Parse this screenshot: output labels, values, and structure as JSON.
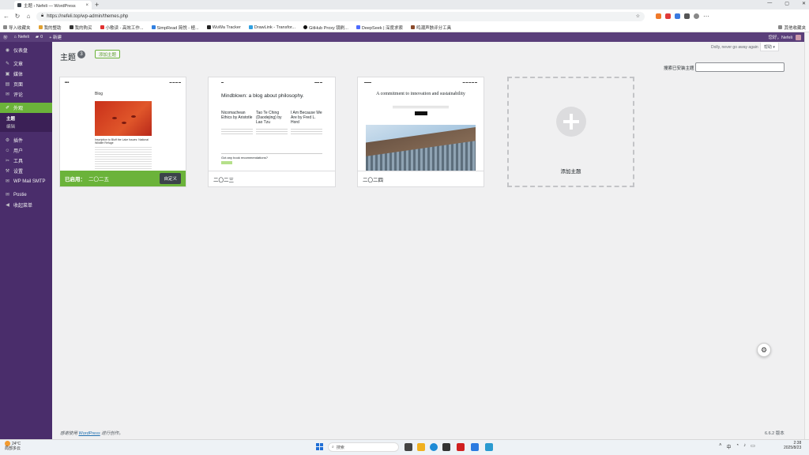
{
  "browser": {
    "tab_title": "主题 ‹ Nefeli — WordPress",
    "tab_close": "×",
    "new_tab": "+",
    "url": "https://nefeli.top/wp-admin/themes.php",
    "window_controls": [
      "—",
      "▢",
      "✕"
    ]
  },
  "bookmarks": {
    "items": [
      "导入收藏夹",
      "我的整助",
      "我的购买",
      "小歌读 - 高效工作...",
      "SimpRead 简悦 - 極...",
      "WuWa Tracker",
      "DrawLink - Transfor...",
      "GitHub Proxy 镜刷...",
      "DeepSeek | 深度求索",
      "鸣潮声骸评分工具"
    ],
    "other": "其他收藏夹"
  },
  "adminbar": {
    "site_name": "Nefeli",
    "comments_count": "0",
    "new_label": "+ 新建",
    "greeting": "您好，Nefeli"
  },
  "sidebar": {
    "items": [
      {
        "label": "仪表盘",
        "icon": "◉"
      },
      {
        "label": "文章",
        "icon": "✎"
      },
      {
        "label": "媒体",
        "icon": "▣"
      },
      {
        "label": "页面",
        "icon": "▤"
      },
      {
        "label": "评论",
        "icon": "✉"
      },
      {
        "label": "外观",
        "icon": "✐"
      },
      {
        "label": "插件",
        "icon": "⚙"
      },
      {
        "label": "用户",
        "icon": "☺"
      },
      {
        "label": "工具",
        "icon": "✂"
      },
      {
        "label": "设置",
        "icon": "⚒"
      },
      {
        "label": "WP Mail SMTP",
        "icon": "✉"
      },
      {
        "label": "Postie",
        "icon": "✉"
      },
      {
        "label": "收起菜单",
        "icon": "◀"
      }
    ],
    "submenu": [
      "主题",
      "编辑"
    ]
  },
  "main": {
    "title": "主题",
    "count": "3",
    "add_new": "添加主题",
    "dolly": "Dolly, never go away again",
    "help": "帮助 ▾",
    "search_label": "搜索已安装主题"
  },
  "themes": [
    {
      "name": "二〇二五",
      "active_prefix": "已启用：",
      "customize": "自定义",
      "preview_blog": "Blog",
      "preview_caption": "Inscription to Bluff the Lake Issues: National Wildlife Refuge"
    },
    {
      "name": "二〇二三",
      "preview_headline": "Mindblown: a blog about philosophy.",
      "preview_posts": [
        "Nicomachean Ethics by Aristotle",
        "Tao Te Ching (Daodejing) by Lao Tzu",
        "I Am Because We Are by Fred L. Hord"
      ],
      "preview_question": "Got any book recommendations?"
    },
    {
      "name": "二〇二四",
      "preview_headline": "A commitment to innovation and sustainability"
    }
  ],
  "add_theme_label": "添加主题",
  "footer": {
    "thanks_prefix": "感谢使用",
    "wp_link": "WordPress",
    "thanks_suffix": "进行创作。",
    "version": "6.6.2 版本"
  },
  "taskbar": {
    "temp": "24°C",
    "weather_desc": "局部多云",
    "search_placeholder": "搜索",
    "time": "2:38",
    "date": "2025/8/23"
  },
  "colors": {
    "adminbar": "#5a3f7a",
    "sidebar": "#4a2d6b",
    "accent": "#6bb33a"
  }
}
